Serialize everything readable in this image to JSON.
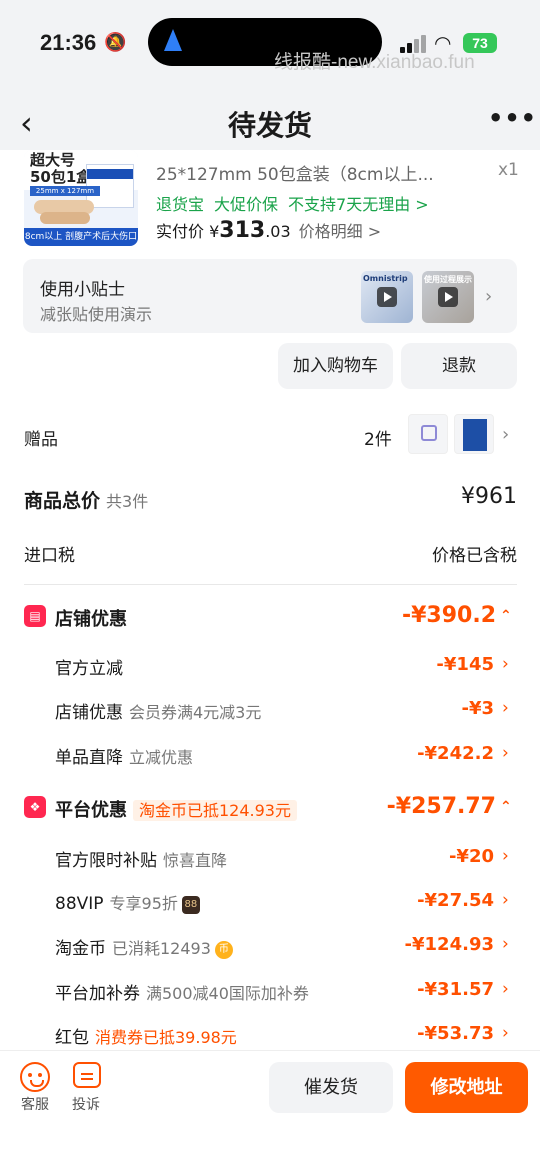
{
  "status_bar": {
    "time": "21:36",
    "battery": "73",
    "watermark": "线报酷-new.xianbao.fun"
  },
  "header": {
    "title": "待发货"
  },
  "product": {
    "thumb_header": "超大号\n50包1盒",
    "thumb_size": "25mm x 127mm",
    "thumb_footer": "8cm以上 剖腹产术后大伤口",
    "name": "25*127mm 50包盒装（8cm以上...",
    "qty": "x1",
    "guarantees": [
      "退货宝",
      "大促价保",
      "不支持7天无理由 >"
    ],
    "paid_label": "实付价 ¥",
    "paid_int": "313",
    "paid_dec": ".03",
    "price_detail": "价格明细 >"
  },
  "tips": {
    "title": "使用小贴士",
    "subtitle": "减张贴使用演示",
    "video1_caption": "Omnistrip",
    "video2_caption": "使用过程展示"
  },
  "actions": {
    "add_cart": "加入购物车",
    "refund": "退款"
  },
  "gift": {
    "label": "赠品",
    "count": "2件"
  },
  "totals": {
    "label": "商品总价",
    "count": "共3件",
    "value": "¥961"
  },
  "tax": {
    "label": "进口税",
    "value": "价格已含税"
  },
  "shop_discount": {
    "label": "店铺优惠",
    "value": "-¥390.2",
    "items": [
      {
        "label": "官方立减",
        "sub": "",
        "value": "-¥145"
      },
      {
        "label": "店铺优惠",
        "sub": "会员券满4元减3元",
        "value": "-¥3"
      },
      {
        "label": "单品直降",
        "sub": "立减优惠",
        "value": "-¥242.2"
      }
    ]
  },
  "platform_discount": {
    "label": "平台优惠",
    "badge": "淘金币已抵124.93元",
    "value": "-¥257.77",
    "items": [
      {
        "label": "官方限时补贴",
        "sub": "惊喜直降",
        "value": "-¥20"
      },
      {
        "label": "88VIP",
        "sub": "专享95折",
        "tag": "88",
        "value": "-¥27.54"
      },
      {
        "label": "淘金币",
        "sub": "已消耗12493",
        "tag": "币",
        "value": "-¥124.93"
      },
      {
        "label": "平台加补券",
        "sub": "满500减40国际加补券",
        "value": "-¥31.57"
      },
      {
        "label": "红包",
        "sub": "消费券已抵39.98元",
        "value": "-¥53.73"
      }
    ]
  },
  "bottom_bar": {
    "service": "客服",
    "complaint": "投诉",
    "urge": "催发货",
    "modify_address": "修改地址"
  },
  "colors": {
    "accent": "#ff5000",
    "green": "#1aa34a",
    "shop_icon": "#ff2750"
  }
}
